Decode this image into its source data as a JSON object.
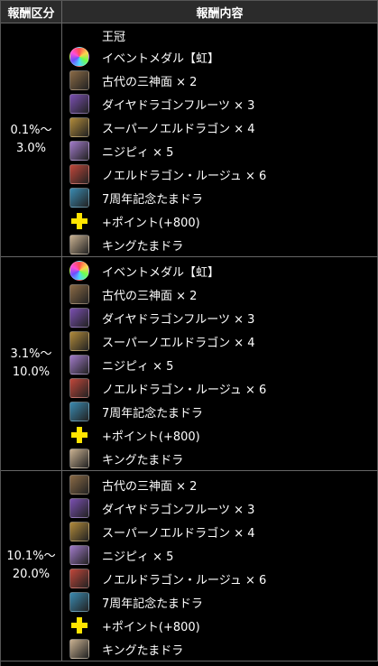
{
  "header": {
    "col1": "報酬区分",
    "col2": "報酬内容"
  },
  "tiers": [
    {
      "range": [
        "0.1%〜",
        "3.0%"
      ],
      "title": "王冠",
      "items": [
        {
          "label": "イベントメダル【虹】",
          "icon": "rainbow-medal-icon",
          "color": "#6b4fd6"
        },
        {
          "label": "古代の三神面 × 2",
          "icon": "ancient-mask-icon",
          "color": "#8a6a45"
        },
        {
          "label": "ダイヤドラゴンフルーツ × 3",
          "icon": "diamond-dragonfruit-icon",
          "color": "#7a4fb0"
        },
        {
          "label": "スーパーノエルドラゴン × 4",
          "icon": "super-noel-dragon-icon",
          "color": "#b08a3a"
        },
        {
          "label": "ニジピィ × 5",
          "icon": "nijipii-icon",
          "color": "#a07ac8"
        },
        {
          "label": "ノエルドラゴン・ルージュ × 6",
          "icon": "noel-dragon-rouge-icon",
          "color": "#c0463a"
        },
        {
          "label": "7周年記念たまドラ",
          "icon": "anniversary-tamadra-icon",
          "color": "#3a8ab0"
        },
        {
          "label": "+ポイント(+800)",
          "icon": "plus-point-icon",
          "color": "#ffe400"
        },
        {
          "label": "キングたまドラ",
          "icon": "king-tamadra-icon",
          "color": "#c8b090"
        }
      ]
    },
    {
      "range": [
        "3.1%〜",
        "10.0%"
      ],
      "title": "",
      "items": [
        {
          "label": "イベントメダル【虹】",
          "icon": "rainbow-medal-icon",
          "color": "#6b4fd6"
        },
        {
          "label": "古代の三神面 × 2",
          "icon": "ancient-mask-icon",
          "color": "#8a6a45"
        },
        {
          "label": "ダイヤドラゴンフルーツ × 3",
          "icon": "diamond-dragonfruit-icon",
          "color": "#7a4fb0"
        },
        {
          "label": "スーパーノエルドラゴン × 4",
          "icon": "super-noel-dragon-icon",
          "color": "#b08a3a"
        },
        {
          "label": "ニジピィ × 5",
          "icon": "nijipii-icon",
          "color": "#a07ac8"
        },
        {
          "label": "ノエルドラゴン・ルージュ × 6",
          "icon": "noel-dragon-rouge-icon",
          "color": "#c0463a"
        },
        {
          "label": "7周年記念たまドラ",
          "icon": "anniversary-tamadra-icon",
          "color": "#3a8ab0"
        },
        {
          "label": "+ポイント(+800)",
          "icon": "plus-point-icon",
          "color": "#ffe400"
        },
        {
          "label": "キングたまドラ",
          "icon": "king-tamadra-icon",
          "color": "#c8b090"
        }
      ]
    },
    {
      "range": [
        "10.1%〜",
        "20.0%"
      ],
      "title": "",
      "items": [
        {
          "label": "古代の三神面 × 2",
          "icon": "ancient-mask-icon",
          "color": "#8a6a45"
        },
        {
          "label": "ダイヤドラゴンフルーツ × 3",
          "icon": "diamond-dragonfruit-icon",
          "color": "#7a4fb0"
        },
        {
          "label": "スーパーノエルドラゴン × 4",
          "icon": "super-noel-dragon-icon",
          "color": "#b08a3a"
        },
        {
          "label": "ニジピィ × 5",
          "icon": "nijipii-icon",
          "color": "#a07ac8"
        },
        {
          "label": "ノエルドラゴン・ルージュ × 6",
          "icon": "noel-dragon-rouge-icon",
          "color": "#c0463a"
        },
        {
          "label": "7周年記念たまドラ",
          "icon": "anniversary-tamadra-icon",
          "color": "#3a8ab0"
        },
        {
          "label": "+ポイント(+800)",
          "icon": "plus-point-icon",
          "color": "#ffe400"
        },
        {
          "label": "キングたまドラ",
          "icon": "king-tamadra-icon",
          "color": "#c8b090"
        }
      ]
    }
  ]
}
